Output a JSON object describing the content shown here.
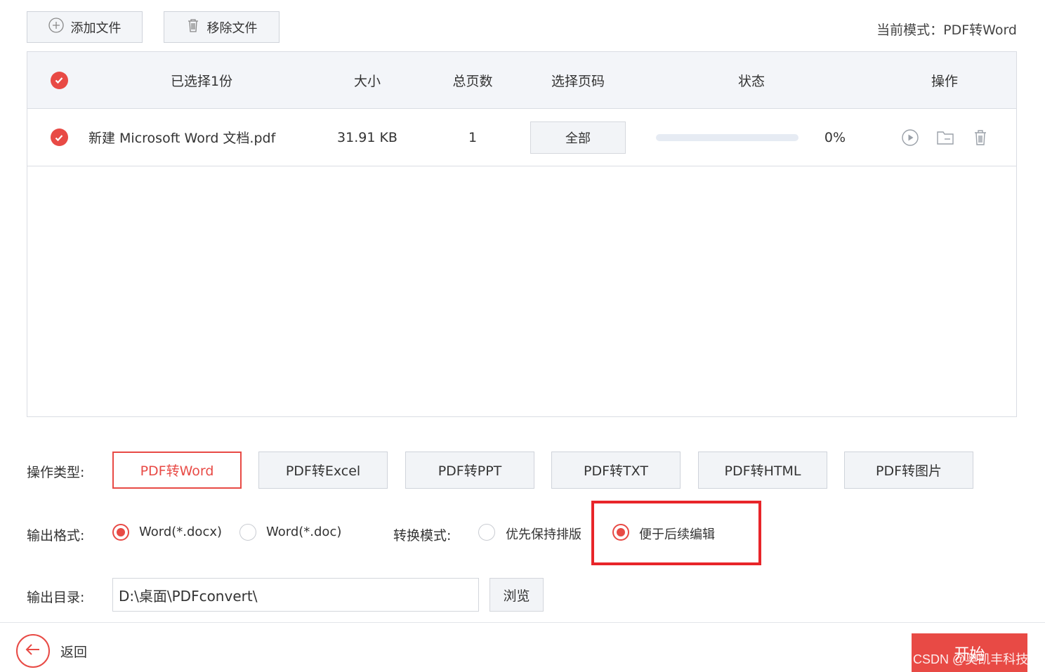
{
  "toolbar": {
    "add_label": "添加文件",
    "remove_label": "移除文件",
    "mode_text": "当前模式：PDF转Word"
  },
  "table": {
    "headers": {
      "selected": "已选择1份",
      "size": "大小",
      "pages": "总页数",
      "page_select": "选择页码",
      "status": "状态",
      "actions": "操作"
    },
    "rows": [
      {
        "filename": "新建 Microsoft Word 文档.pdf",
        "size": "31.91 KB",
        "pages": "1",
        "page_select": "全部",
        "progress": 0,
        "progress_text": "0%",
        "checked": true
      }
    ]
  },
  "options": {
    "op_type_label": "操作类型:",
    "op_types": [
      "PDF转Word",
      "PDF转Excel",
      "PDF转PPT",
      "PDF转TXT",
      "PDF转HTML",
      "PDF转图片"
    ],
    "active_op_type": "PDF转Word",
    "output_format_label": "输出格式:",
    "formats": [
      "Word(*.docx)",
      "Word(*.doc)"
    ],
    "selected_format": "Word(*.docx)",
    "convert_mode_label": "转换模式:",
    "modes": [
      "优先保持排版",
      "便于后续编辑"
    ],
    "selected_mode": "便于后续编辑",
    "output_dir_label": "输出目录:",
    "output_dir": "D:\\桌面\\PDFconvert\\",
    "browse_label": "浏览"
  },
  "footer": {
    "back_label": "返回",
    "start_label": "开始",
    "watermark": "CSDN @奥凯丰科技"
  },
  "colors": {
    "accent": "#e84a45",
    "highlight_box": "#e8252a"
  }
}
